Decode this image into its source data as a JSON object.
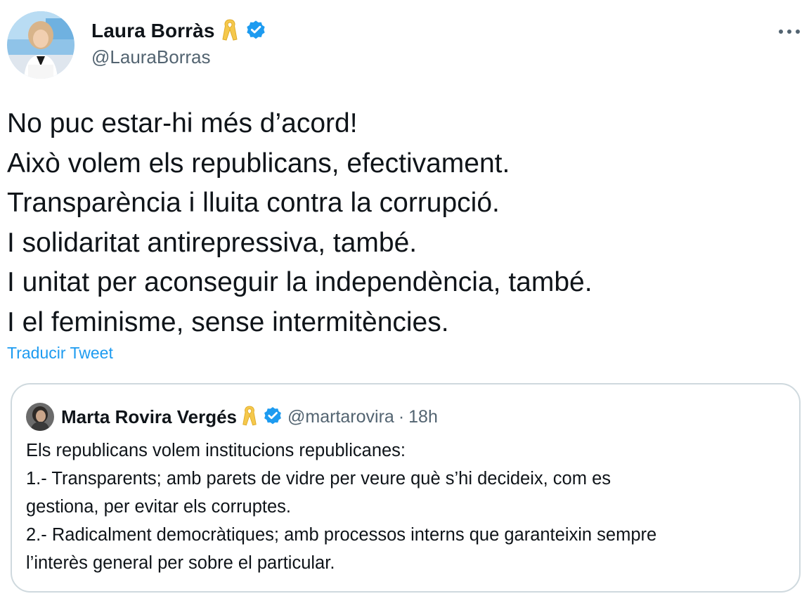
{
  "tweet": {
    "author_name": "Laura Borràs",
    "author_handle": "@LauraBorras",
    "ribbon_icon": "yellow-ribbon-icon",
    "verified_icon": "verified-badge-icon",
    "more_icon": "more-options-icon",
    "lines": [
      "No puc estar-hi més d’acord!",
      "Això volem els republicans, efectivament.",
      "Transparència i lluita contra la corrupció.",
      "I solidaritat antirepressiva, també.",
      "I unitat per aconseguir la independència, també.",
      "I el feminisme, sense intermitències."
    ],
    "translate_label": "Traducir Tweet"
  },
  "quote": {
    "author_name": "Marta Rovira Vergés",
    "author_handle": "@martarovira",
    "separator": "·",
    "time": "18h",
    "lines": [
      "Els republicans volem institucions republicanes:",
      "1.- Transparents; amb parets de vidre per veure què s’hi decideix, com es",
      "gestiona, per evitar els corruptes.",
      "2.- Radicalment democràtiques; amb processos interns que garanteixin sempre",
      "l’interès general per sobre el particular."
    ]
  },
  "colors": {
    "text_primary": "#0f1419",
    "text_secondary": "#536471",
    "link": "#1d9bf0",
    "verified": "#1d9bf0",
    "ribbon": "#f5c84c",
    "card_border": "#cfd9de"
  }
}
